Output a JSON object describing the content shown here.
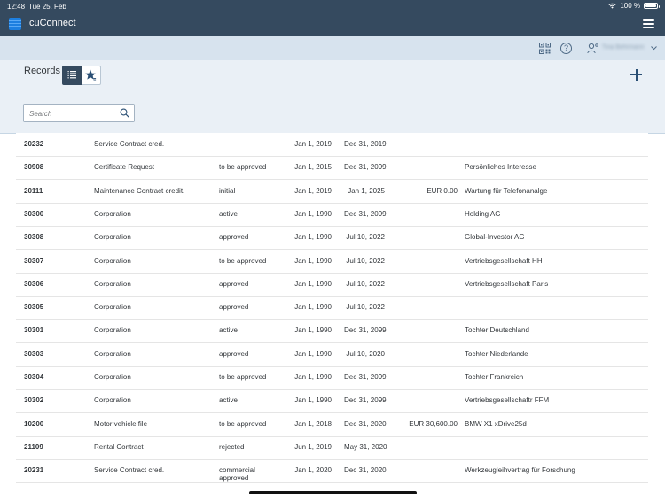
{
  "status_bar": {
    "time": "12:48",
    "date": "Tue 25. Feb",
    "battery": "100 %",
    "battery_level": 1.0
  },
  "app": {
    "title": "cuConnect",
    "logo_icon": "app-logo-icon",
    "menu_icon": "hamburger-menu-icon"
  },
  "shell": {
    "qr_icon": "qr-code-icon",
    "help_icon": "help-icon",
    "help_glyph": "?",
    "user_icon": "user-settings-icon",
    "user_name": "Tina Behrmann"
  },
  "records": {
    "title": "Records",
    "list_view_icon": "list-view-icon",
    "favorites_icon": "star-favorites-icon",
    "add_icon": "plus-icon",
    "search": {
      "placeholder": "Search",
      "value": ""
    }
  },
  "colors": {
    "topbar": "#354a5f",
    "shellbar": "#d7e3ee",
    "header": "#eaf0f6",
    "accent": "#2a4f74"
  },
  "table": {
    "rows": [
      {
        "id": "20232",
        "type": "Service Contract cred.",
        "status": "",
        "start": "Jan 1, 2019",
        "end": "Dec 31, 2019",
        "amount": "",
        "description": ""
      },
      {
        "id": "30908",
        "type": "Certificate Request",
        "status": "to be approved",
        "start": "Jan 1, 2015",
        "end": "Dec 31, 2099",
        "amount": "",
        "description": "Persönliches Interesse"
      },
      {
        "id": "20111",
        "type": "Maintenance Contract credit.",
        "status": "initial",
        "start": "Jan 1, 2019",
        "end": "Jan 1, 2025",
        "amount": "EUR 0.00",
        "description": "Wartung für Telefonanalge"
      },
      {
        "id": "30300",
        "type": "Corporation",
        "status": "active",
        "start": "Jan 1, 1990",
        "end": "Dec 31, 2099",
        "amount": "",
        "description": "Holding AG"
      },
      {
        "id": "30308",
        "type": "Corporation",
        "status": "approved",
        "start": "Jan 1, 1990",
        "end": "Jul 10, 2022",
        "amount": "",
        "description": "Global-Investor AG"
      },
      {
        "id": "30307",
        "type": "Corporation",
        "status": "to be approved",
        "start": "Jan 1, 1990",
        "end": "Jul 10, 2022",
        "amount": "",
        "description": "Vertriebsgesellschaft HH"
      },
      {
        "id": "30306",
        "type": "Corporation",
        "status": "approved",
        "start": "Jan 1, 1990",
        "end": "Jul 10, 2022",
        "amount": "",
        "description": "Vertriebsgesellschaft Paris"
      },
      {
        "id": "30305",
        "type": "Corporation",
        "status": "approved",
        "start": "Jan 1, 1990",
        "end": "Jul 10, 2022",
        "amount": "",
        "description": ""
      },
      {
        "id": "30301",
        "type": "Corporation",
        "status": "active",
        "start": "Jan 1, 1990",
        "end": "Dec 31, 2099",
        "amount": "",
        "description": "Tochter Deutschland"
      },
      {
        "id": "30303",
        "type": "Corporation",
        "status": "approved",
        "start": "Jan 1, 1990",
        "end": "Jul 10, 2020",
        "amount": "",
        "description": "Tochter Niederlande"
      },
      {
        "id": "30304",
        "type": "Corporation",
        "status": "to be approved",
        "start": "Jan 1, 1990",
        "end": "Dec 31, 2099",
        "amount": "",
        "description": "Tochter Frankreich"
      },
      {
        "id": "30302",
        "type": "Corporation",
        "status": "active",
        "start": "Jan 1, 1990",
        "end": "Dec 31, 2099",
        "amount": "",
        "description": "Vertriebsgesellschaftr FFM"
      },
      {
        "id": "10200",
        "type": "Motor vehicle file",
        "status": "to be approved",
        "start": "Jan 1, 2018",
        "end": "Dec 31, 2020",
        "amount": "EUR 30,600.00",
        "description": "BMW X1 xDrive25d"
      },
      {
        "id": "21109",
        "type": "Rental Contract",
        "status": "rejected",
        "start": "Jun 1, 2019",
        "end": "May 31, 2020",
        "amount": "",
        "description": ""
      },
      {
        "id": "20231",
        "type": "Service Contract cred.",
        "status": "commercial approved",
        "start": "Jan 1, 2020",
        "end": "Dec 31, 2020",
        "amount": "",
        "description": "Werkzeugleihvertrag für Forschung"
      }
    ]
  }
}
